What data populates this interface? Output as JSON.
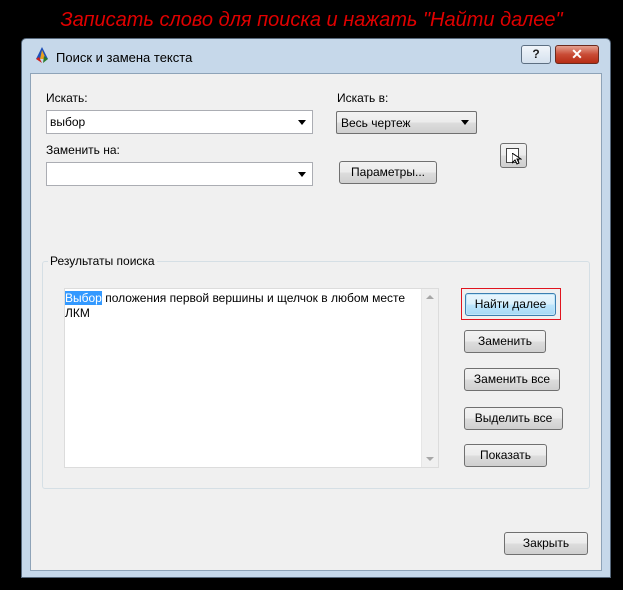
{
  "annotation": "Записать слово для поиска и нажать \"Найти далее\"",
  "window": {
    "title": "Поиск и замена текста",
    "help_label": "?",
    "close_label": "✕"
  },
  "search": {
    "label": "Искать:",
    "value": "выбор"
  },
  "search_in": {
    "label": "Искать в:",
    "value": "Весь чертеж"
  },
  "replace": {
    "label": "Заменить на:",
    "value": ""
  },
  "params_label": "Параметры...",
  "results": {
    "title": "Результаты поиска",
    "highlight": "Выбор",
    "text": " положения первой вершины и щелчок в любом месте ЛКМ"
  },
  "buttons": {
    "find_next": "Найти далее",
    "replace": "Заменить",
    "replace_all": "Заменить все",
    "select_all": "Выделить все",
    "show": "Показать",
    "close": "Закрыть"
  },
  "colors": {
    "annotation": "#e00000",
    "highlight": "#3399ff",
    "focus_outline": "#e0141e"
  }
}
